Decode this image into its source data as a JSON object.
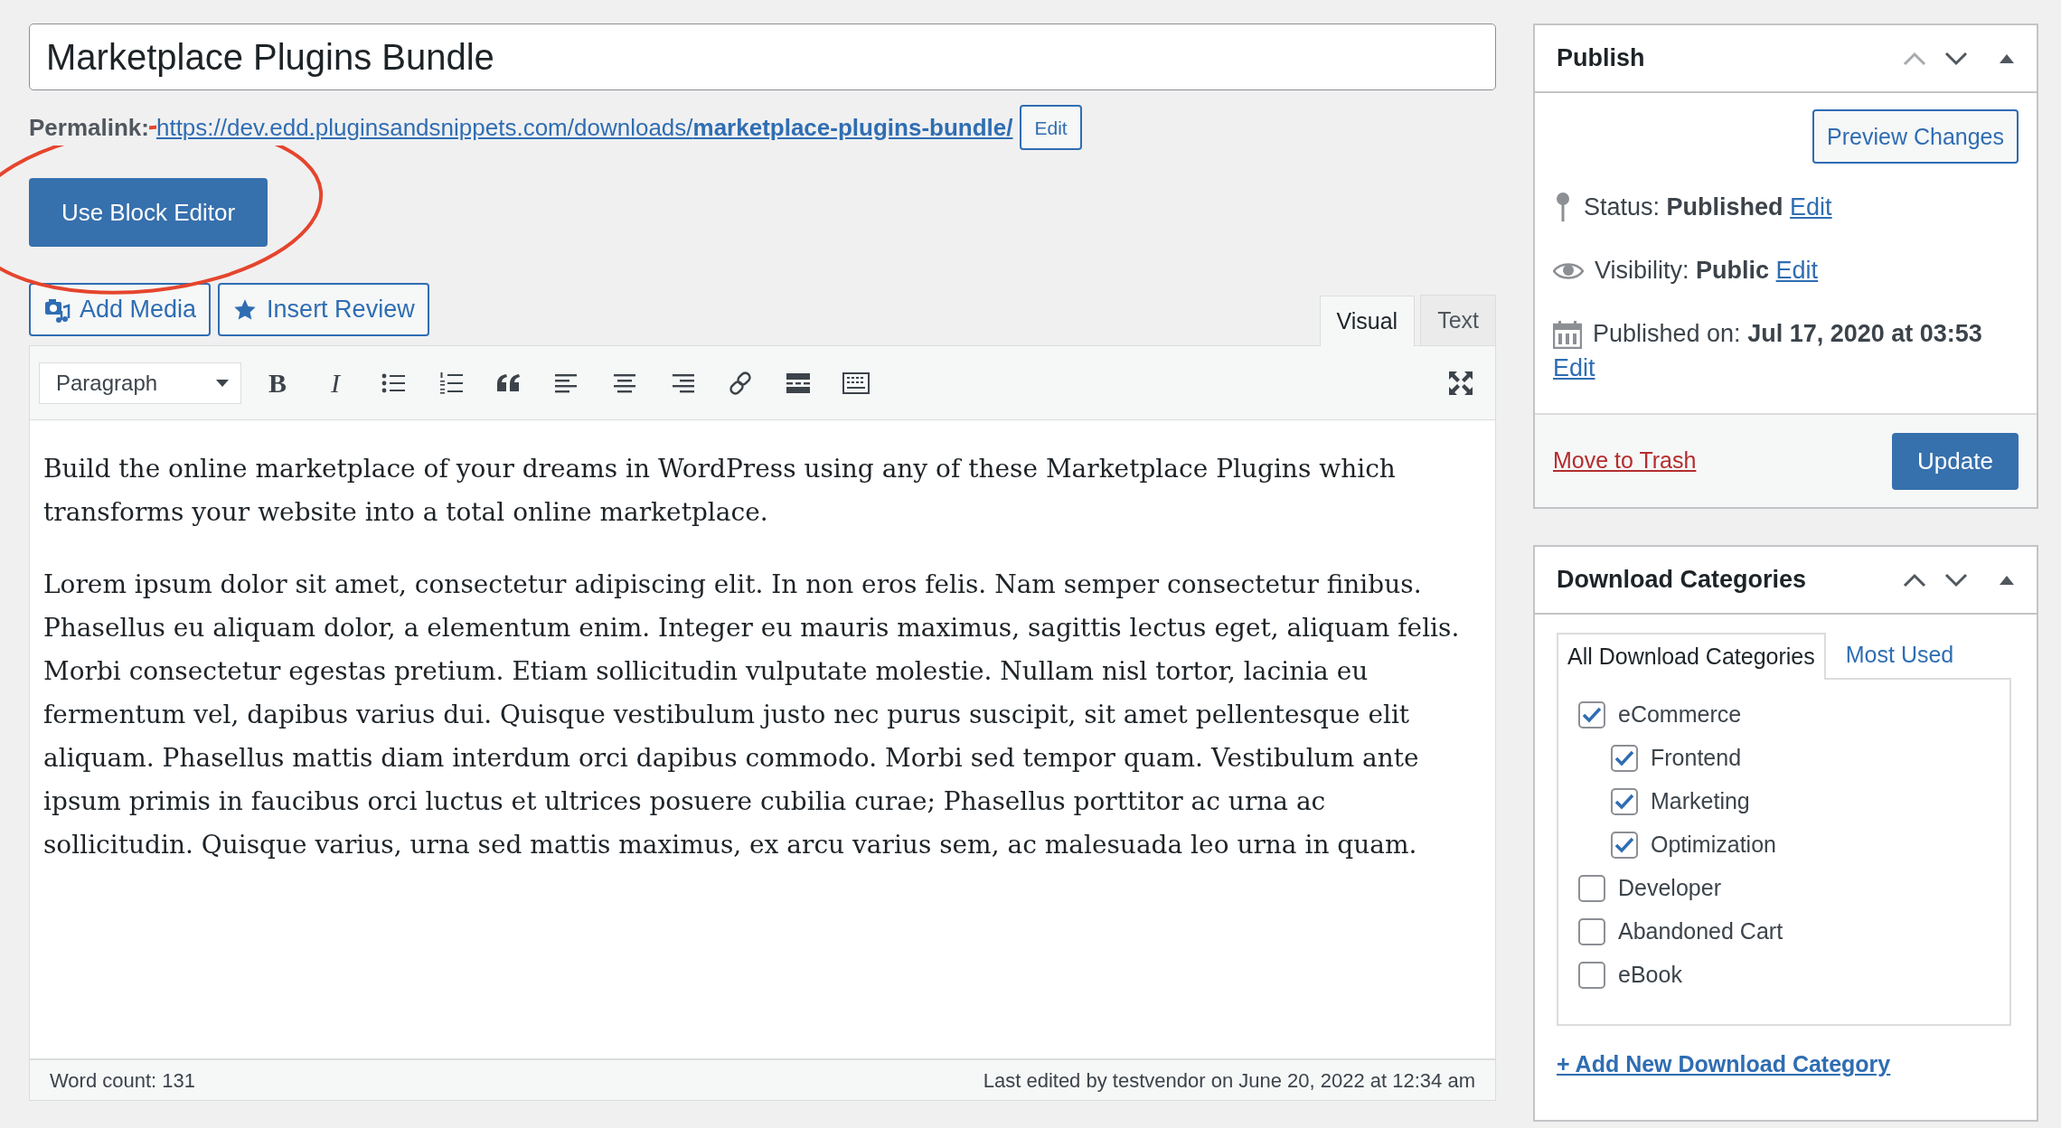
{
  "title_field": {
    "value": "Marketplace Plugins Bundle"
  },
  "permalink": {
    "label": "Permalink:",
    "url_base": "https://dev.edd.pluginsandsnippets.com/downloads/",
    "slug": "marketplace-plugins-bundle/",
    "edit_button": "Edit"
  },
  "block_editor_button": "Use Block Editor",
  "media_buttons": [
    {
      "kind": "media",
      "label": "Add Media"
    },
    {
      "kind": "star",
      "label": "Insert Review"
    }
  ],
  "editor_tabs": [
    {
      "label": "Visual",
      "selected": true
    },
    {
      "label": "Text",
      "selected": false
    }
  ],
  "toolbar": {
    "format_select": "Paragraph",
    "buttons": [
      {
        "kind": "bold",
        "glyph": "B"
      },
      {
        "kind": "italic",
        "glyph": "I"
      },
      {
        "kind": "bullet-list"
      },
      {
        "kind": "numbered-list"
      },
      {
        "kind": "quote"
      },
      {
        "kind": "align-left"
      },
      {
        "kind": "align-center"
      },
      {
        "kind": "align-right"
      },
      {
        "kind": "link"
      },
      {
        "kind": "read-more"
      },
      {
        "kind": "toolbar-toggle"
      }
    ]
  },
  "content": {
    "paragraphs": [
      "Build the online marketplace of your dreams in WordPress using any of these Marketplace Plugins which transforms your website into a total online marketplace.",
      "Lorem ipsum dolor sit amet, consectetur adipiscing elit. In non eros felis. Nam semper consectetur finibus. Phasellus eu aliquam dolor, a elementum enim. Integer eu mauris maximus, sagittis lectus eget, aliquam felis. Morbi consectetur egestas pretium. Etiam sollicitudin vulputate molestie. Nullam nisl tortor, lacinia eu fermentum vel, dapibus varius dui. Quisque vestibulum justo nec purus suscipit, sit amet pellentesque elit aliquam. Phasellus mattis diam interdum orci dapibus commodo. Morbi sed tempor quam. Vestibulum ante ipsum primis in faucibus orci luctus et ultrices posuere cubilia curae; Phasellus porttitor ac urna ac sollicitudin. Quisque varius, urna sed mattis maximus, ex arcu varius sem, ac malesuada leo urna in quam."
    ]
  },
  "status_bar": {
    "word_count": "Word count: 131",
    "last_edited": "Last edited by testvendor on June 20, 2022 at 12:34 am"
  },
  "publish_box": {
    "title": "Publish",
    "can_move_up": false,
    "preview_button": "Preview Changes",
    "rows": [
      {
        "kind": "pin",
        "label": "Status:",
        "value": "Published",
        "link": "Edit"
      },
      {
        "kind": "eye",
        "label": "Visibility:",
        "value": "Public",
        "link": "Edit"
      },
      {
        "kind": "calendar",
        "label": "Published on:",
        "value": "Jul 17, 2020 at 03:53",
        "link": "Edit"
      }
    ],
    "trash_link": "Move to Trash",
    "update_button": "Update"
  },
  "categories_box": {
    "title": "Download Categories",
    "can_move_up": true,
    "tabs": [
      {
        "label": "All Download Categories",
        "selected": true
      },
      {
        "label": "Most Used",
        "selected": false
      }
    ],
    "items": [
      {
        "label": "eCommerce",
        "checked": true,
        "children": [
          {
            "label": "Frontend",
            "checked": true
          },
          {
            "label": "Marketing",
            "checked": true
          },
          {
            "label": "Optimization",
            "checked": true
          }
        ]
      },
      {
        "label": "Developer",
        "checked": false
      },
      {
        "label": "Abandoned Cart",
        "checked": false
      },
      {
        "label": "eBook",
        "checked": false
      }
    ],
    "add_link": "+ Add New Download Category"
  }
}
